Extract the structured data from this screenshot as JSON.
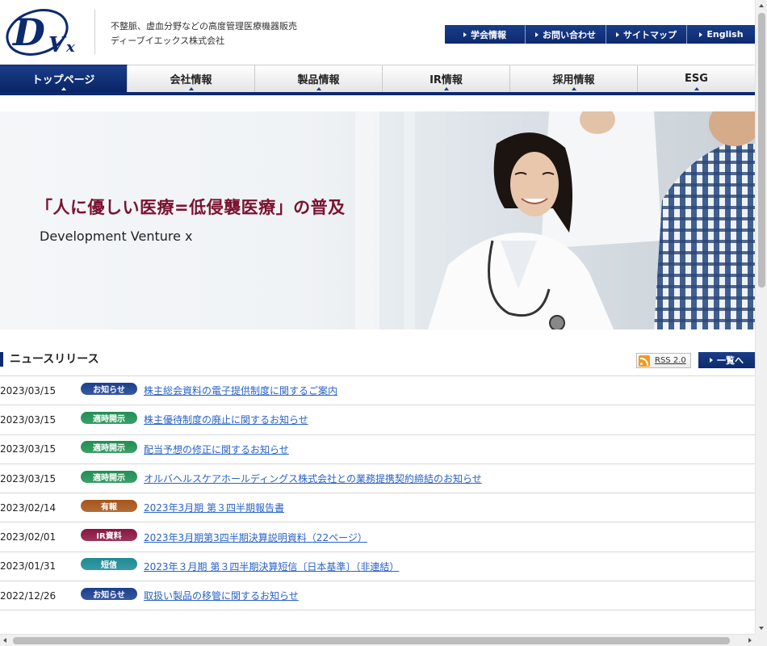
{
  "header": {
    "logo_text": "DVx",
    "tagline_line1": "不整脈、虚血分野などの高度管理医療機器販売",
    "tagline_line2": "ディーブイエックス株式会社"
  },
  "topnav": [
    {
      "label": "学会情報"
    },
    {
      "label": "お問い合わせ"
    },
    {
      "label": "サイトマップ"
    },
    {
      "label": "English"
    }
  ],
  "mainnav": [
    {
      "label": "トップページ",
      "active": true
    },
    {
      "label": "会社情報",
      "active": false
    },
    {
      "label": "製品情報",
      "active": false
    },
    {
      "label": "IR情報",
      "active": false
    },
    {
      "label": "採用情報",
      "active": false
    },
    {
      "label": "ESG",
      "active": false
    }
  ],
  "hero": {
    "title": "「人に優しい医療=低侵襲医療」の普及",
    "subtitle": "Development Venture x"
  },
  "news": {
    "heading": "ニュースリリース",
    "rss_label": "RSS 2.0",
    "more_label": "一覧へ",
    "items": [
      {
        "date": "2023/03/15",
        "badge": "お知らせ",
        "badge_color": "#1b3f8f",
        "title": "株主総会資料の電子提供制度に関するご案内"
      },
      {
        "date": "2023/03/15",
        "badge": "適時開示",
        "badge_color": "#1f8f52",
        "title": "株主優待制度の廃止に関するお知らせ"
      },
      {
        "date": "2023/03/15",
        "badge": "適時開示",
        "badge_color": "#1f8f52",
        "title": "配当予想の修正に関するお知らせ"
      },
      {
        "date": "2023/03/15",
        "badge": "適時開示",
        "badge_color": "#1f8f52",
        "title": "オルバヘルスケアホールディングス株式会社との業務提携契約締結のお知らせ"
      },
      {
        "date": "2023/02/14",
        "badge": "有報",
        "badge_color": "#a7551a",
        "title": "2023年3月期 第３四半期報告書"
      },
      {
        "date": "2023/02/01",
        "badge": "IR資料",
        "badge_color": "#8a1740",
        "title": "2023年3月期第3四半期決算説明資料（22ページ）"
      },
      {
        "date": "2023/01/31",
        "badge": "短信",
        "badge_color": "#1d8a95",
        "title": "2023年３月期 第３四半期決算短信〔日本基準〕（非連結）"
      },
      {
        "date": "2022/12/26",
        "badge": "お知らせ",
        "badge_color": "#1b3f8f",
        "title": "取扱い製品の移管に関するお知らせ"
      }
    ]
  },
  "colors": {
    "brand_navy": "#0c2a6e",
    "hero_title": "#7a1230",
    "link": "#2a63c7"
  }
}
